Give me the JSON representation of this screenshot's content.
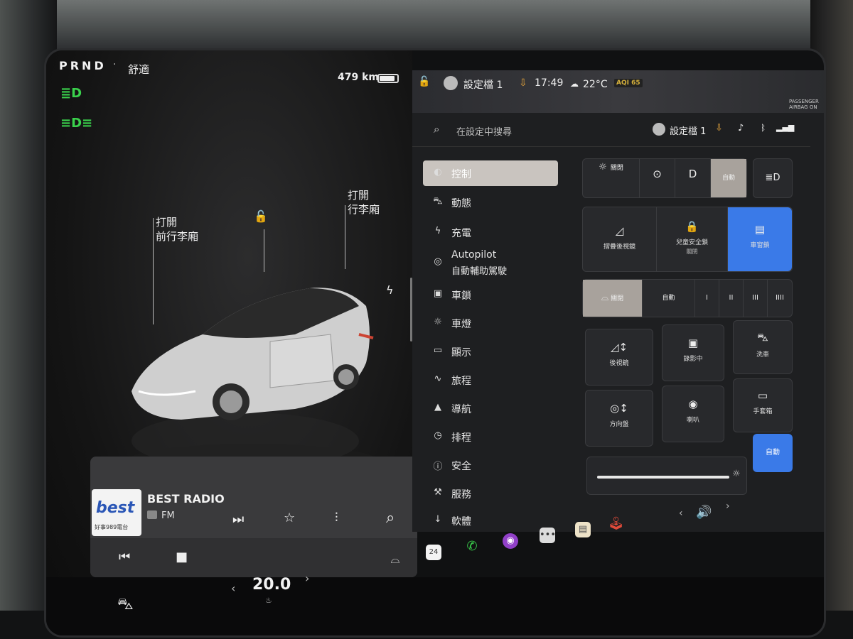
{
  "header": {
    "gears": "PRND",
    "drive_mode": "舒適",
    "range": "479 km",
    "battery_level": 0.8
  },
  "car_view": {
    "frunk_label": "打開\n前行李廂",
    "trunk_label": "打開\n行李廂"
  },
  "media": {
    "station_name": "BEST RADIO",
    "band": "FM",
    "logo_text": "best",
    "logo_sub": "好事989電台",
    "controls": {
      "prev": "⏮",
      "stop": "■",
      "next": "⏭",
      "favorite": "☆",
      "eq": "⫶",
      "search": "⌕"
    }
  },
  "climate": {
    "temperature": "20.0",
    "left_arrow": "‹",
    "right_arrow": "›"
  },
  "status": {
    "profile_name": "設定檔 1",
    "time": "17:49",
    "outside_temp": "22°C",
    "aqi": "AQI 65",
    "airbag_line1": "PASSENGER",
    "airbag_line2": "AIRBAG ON"
  },
  "search": {
    "placeholder": "在設定中搜尋",
    "profile_name": "設定檔 1"
  },
  "menu": [
    {
      "label": "控制",
      "icon": "toggle-icon",
      "glyph": "◐"
    },
    {
      "label": "動態",
      "icon": "car-icon",
      "glyph": "⛍"
    },
    {
      "label": "充電",
      "icon": "bolt-icon",
      "glyph": "ϟ"
    },
    {
      "label": "Autopilot",
      "sub": "自動輔助駕駛",
      "icon": "steering-wheel-icon",
      "glyph": "◎"
    },
    {
      "label": "車鎖",
      "icon": "lock-icon",
      "glyph": "▣"
    },
    {
      "label": "車燈",
      "icon": "light-icon",
      "glyph": "☼"
    },
    {
      "label": "顯示",
      "icon": "display-icon",
      "glyph": "▭"
    },
    {
      "label": "旅程",
      "icon": "trip-icon",
      "glyph": "∿"
    },
    {
      "label": "導航",
      "icon": "navigation-icon",
      "glyph": "▲"
    },
    {
      "label": "排程",
      "icon": "alarm-icon",
      "glyph": "◷"
    },
    {
      "label": "安全",
      "icon": "info-icon",
      "glyph": "ⓘ"
    },
    {
      "label": "服務",
      "icon": "wrench-icon",
      "glyph": "⚒"
    },
    {
      "label": "軟體",
      "icon": "download-icon",
      "glyph": "↓"
    }
  ],
  "controls": {
    "lights_row": [
      {
        "label": "關閉",
        "glyph": "☼"
      },
      {
        "label": "",
        "glyph": "⊙"
      },
      {
        "label": "",
        "glyph": "D"
      },
      {
        "label": "自動",
        "glyph": ""
      }
    ],
    "high_beam_glyph": "≣D",
    "mirror_row": [
      {
        "label": "摺疊後視鏡",
        "sub": "",
        "glyph": "◿"
      },
      {
        "label": "兒童安全鎖",
        "sub": "關閉",
        "glyph": "🔒"
      },
      {
        "label": "車窗鎖",
        "sub": "",
        "glyph": "▤"
      }
    ],
    "wiper_row": [
      {
        "label": "關閉",
        "glyph": "⌓"
      },
      {
        "label": "自動",
        "glyph": ""
      },
      {
        "label": "",
        "glyph": "I"
      },
      {
        "label": "",
        "glyph": "II"
      },
      {
        "label": "",
        "glyph": "III"
      },
      {
        "label": "",
        "glyph": "IIII"
      }
    ],
    "tiles": [
      {
        "label": "後視鏡",
        "glyph": "◿↕"
      },
      {
        "label": "錄影中",
        "glyph": "▣"
      },
      {
        "label": "洗車",
        "glyph": "⛍"
      },
      {
        "label": "方向盤",
        "glyph": "◎↕"
      },
      {
        "label": "喇叭",
        "glyph": "◉"
      },
      {
        "label": "手套箱",
        "glyph": "▭"
      }
    ],
    "brightness_auto": "自動",
    "brightness_level": 0.9
  },
  "dock": {
    "calendar_day": "24",
    "volume_left": "‹",
    "volume_right": "›"
  },
  "colors": {
    "green_lights": "#3ad24c",
    "accent_blue": "#3a7ae8",
    "selected_tile": "#a8a29c"
  }
}
